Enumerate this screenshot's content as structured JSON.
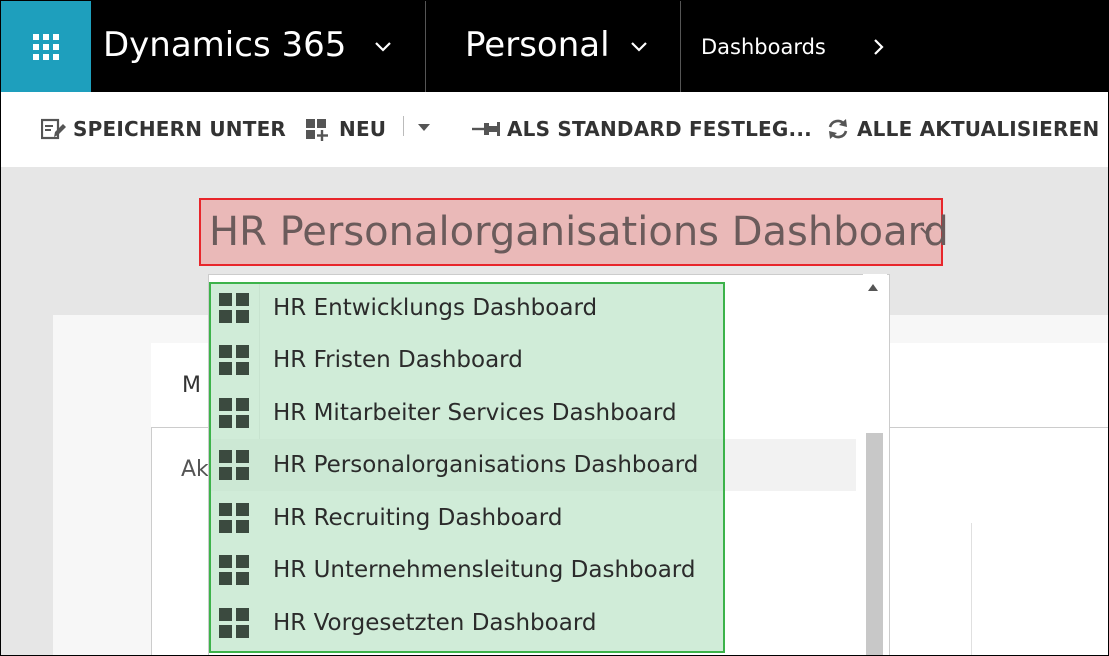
{
  "topnav": {
    "brand": "Dynamics 365",
    "area": "Personal",
    "breadcrumb": "Dashboards"
  },
  "commandbar": {
    "save_as": "SPEICHERN UNTER",
    "new": "NEU",
    "set_default": "ALS STANDARD FESTLEG...",
    "refresh_all": "ALLE AKTUALISIEREN"
  },
  "selector": {
    "title": "HR Personalorganisations Dashboard"
  },
  "background": {
    "letter_1": "M",
    "letter_2": "Ak"
  },
  "dropdown": {
    "items": [
      {
        "label": "HR Entwicklungs Dashboard"
      },
      {
        "label": "HR Fristen Dashboard"
      },
      {
        "label": "HR Mitarbeiter Services Dashboard"
      },
      {
        "label": "HR Personalorganisations Dashboard"
      },
      {
        "label": "HR Recruiting Dashboard"
      },
      {
        "label": "HR Unternehmensleitung Dashboard"
      },
      {
        "label": "HR Vorgesetzten Dashboard"
      }
    ]
  },
  "colors": {
    "waffle_bg": "#1e9fbd",
    "topnav_bg": "#000000",
    "selector_highlight": "#e8262b",
    "list_highlight": "#3cb34a"
  }
}
